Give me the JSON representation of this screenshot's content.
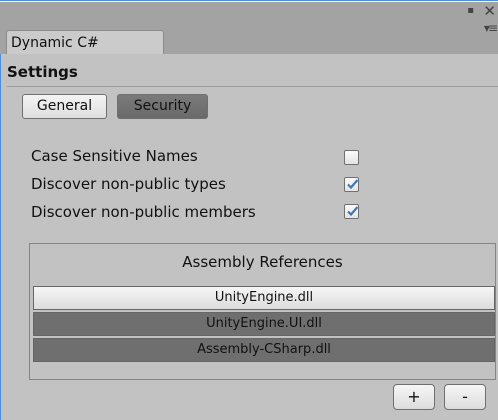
{
  "window": {
    "tab_title": "Dynamic C#",
    "maximize_glyph": "▪",
    "close_glyph": "✕",
    "menu_glyph": "▾≡"
  },
  "settings": {
    "header": "Settings",
    "tabs": [
      {
        "label": "General",
        "active": false
      },
      {
        "label": "Security",
        "active": true
      }
    ],
    "options": [
      {
        "label": "Case Sensitive Names",
        "checked": false
      },
      {
        "label": "Discover non-public types",
        "checked": true
      },
      {
        "label": "Discover non-public members",
        "checked": true
      }
    ]
  },
  "assembly_references": {
    "title": "Assembly References",
    "items": [
      {
        "label": "UnityEngine.dll",
        "selected": true
      },
      {
        "label": "UnityEngine.UI.dll",
        "selected": false
      },
      {
        "label": "Assembly-CSharp.dll",
        "selected": false
      }
    ],
    "add_label": "+",
    "remove_label": "-"
  },
  "colors": {
    "check_accent": "#3f78b5",
    "panel_bg": "#c2c2c2",
    "titlebar_bg": "#a3a3a3"
  }
}
